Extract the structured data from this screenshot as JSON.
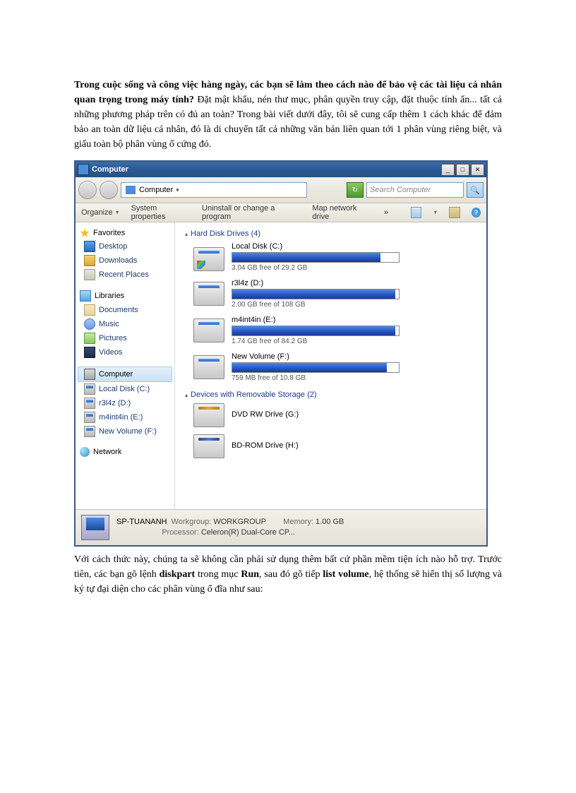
{
  "para1_bold": "Trong cuộc sống và công việc hàng ngày, các bạn sẽ làm theo cách nào để bảo vệ các tài liệu cá nhân quan trọng trong máy tính?",
  "para1_rest": " Đặt mật khẩu, nén thư mục, phân quyền truy cập, đặt thuộc tính ẩn... tất cả những phương pháp trên có đủ an toàn? Trong bài viết dưới đây, tôi sẽ cung cấp thêm 1 cách khác để đảm bảo an toàn dữ liệu cá nhân, đó là di chuyển tất cả những văn bản liên quan tới 1 phân vùng riêng biệt, và giấu toàn bộ phân vùng ổ cứng đó.",
  "para2_a": "Với cách thức này, chúng ta sẽ không cần phải sử dụng thêm bất cứ phần mềm tiện ích nào hỗ trợ. Trước tiên, các bạn gõ lệnh ",
  "para2_kw1": "diskpart",
  "para2_b": " trong mục ",
  "para2_kw2": "Run",
  "para2_c": ", sau đó gõ tiếp ",
  "para2_kw3": "list volume",
  "para2_d": ", hệ thống sẽ hiển thị số lượng và ký tự đại diện cho các phân vùng ổ đĩa như sau:",
  "win": {
    "title": "Computer",
    "crumb": "Computer",
    "search_ph": "Search Computer",
    "toolbar": {
      "organize": "Organize",
      "sysprop": "System properties",
      "uninstall": "Uninstall or change a program",
      "mapnet": "Map network drive",
      "more": "»"
    },
    "sidebar": {
      "fav": "Favorites",
      "fav_items": [
        "Desktop",
        "Downloads",
        "Recent Places"
      ],
      "lib": "Libraries",
      "lib_items": [
        "Documents",
        "Music",
        "Pictures",
        "Videos"
      ],
      "comp": "Computer",
      "comp_items": [
        "Local Disk (C:)",
        "r3l4z (D:)",
        "m4int4in (E:)",
        "New Volume (F:)"
      ],
      "net": "Network"
    },
    "hdr1": "Hard Disk Drives (4)",
    "drives": [
      {
        "name": "Local Disk (C:)",
        "free": "3.04 GB free of 29.2 GB",
        "pct": 89
      },
      {
        "name": "r3l4z (D:)",
        "free": "2.00 GB free of 108 GB",
        "pct": 98
      },
      {
        "name": "m4int4in (E:)",
        "free": "1.74 GB free of 84.2 GB",
        "pct": 98
      },
      {
        "name": "New Volume (F:)",
        "free": "759 MB free of 10.8 GB",
        "pct": 93
      }
    ],
    "hdr2": "Devices with Removable Storage (2)",
    "remov": [
      {
        "name": "DVD RW Drive (G:)",
        "type": "dvd"
      },
      {
        "name": "BD-ROM Drive (H:)",
        "type": "bd"
      }
    ],
    "status": {
      "name": "SP-TUANANH",
      "wg_lbl": "Workgroup:",
      "wg": "WORKGROUP",
      "mem_lbl": "Memory:",
      "mem": "1.00 GB",
      "proc_lbl": "Processor:",
      "proc": "Celeron(R) Dual-Core CP..."
    }
  }
}
